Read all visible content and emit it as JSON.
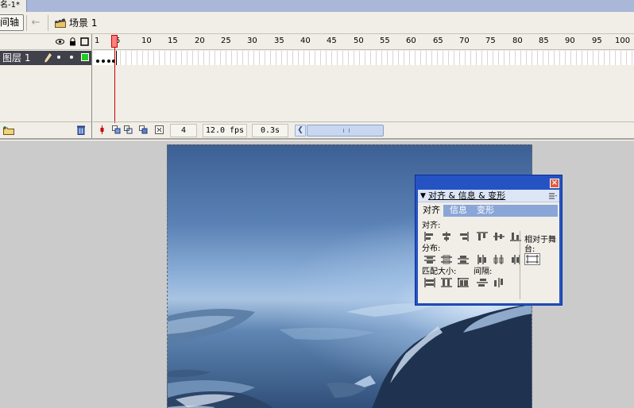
{
  "document_tab": {
    "title": "名-1*"
  },
  "nav_bar": {
    "timeline_label": "间轴",
    "scene_label": "场景 1"
  },
  "timeline": {
    "layer_name": "图层 1",
    "frame_ruler": [
      "1",
      "5",
      "10",
      "15",
      "20",
      "25",
      "30",
      "35",
      "40",
      "45",
      "50",
      "55",
      "60",
      "65",
      "70",
      "75",
      "80",
      "85",
      "90",
      "95",
      "100"
    ],
    "current_frame": "4",
    "frame_rate": "12.0 fps",
    "elapsed_time": "0.3s",
    "playhead_frame": 4
  },
  "align_panel": {
    "header": "对齐 & 信息 & 变形",
    "tabs": [
      "对齐",
      "信息",
      "变形"
    ],
    "active_tab": "对齐",
    "labels": {
      "align": "对齐:",
      "distribute": "分布:",
      "match_size": "匹配大小:",
      "spacing": "间隔:",
      "relative_to_stage": "相对于舞台:"
    }
  },
  "colors": {
    "layer_row": "#41414b",
    "outline_color": "#22cc22",
    "panel_title": "#2553c4",
    "playhead": "#cc0000"
  }
}
